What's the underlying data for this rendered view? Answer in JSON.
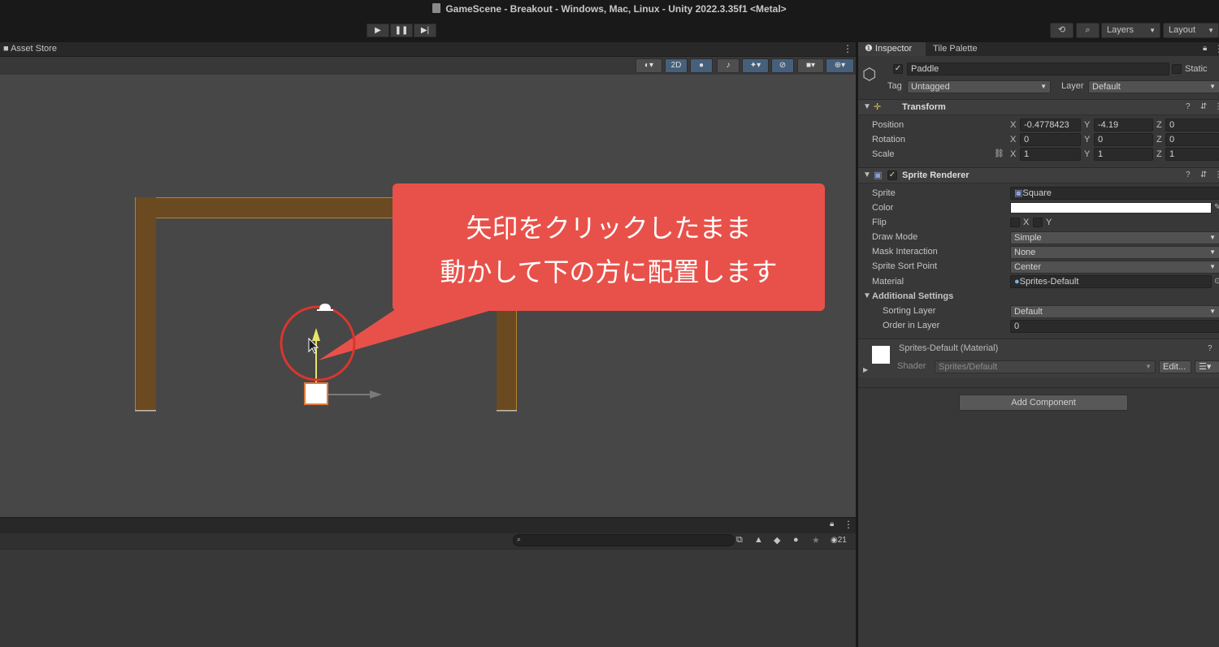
{
  "window": {
    "title": "GameScene - Breakout - Windows, Mac, Linux - Unity 2022.3.35f1 <Metal>"
  },
  "toolbar": {
    "play_icon": "play-icon",
    "pause_icon": "pause-icon",
    "step_icon": "step-icon",
    "layers_label": "Layers",
    "layout_label": "Layout"
  },
  "scene": {
    "tab_label": "Asset Store",
    "mode_2d_label": "2D",
    "callout_lines": [
      "矢印をクリックしたまま",
      "動かして下の方に配置します"
    ]
  },
  "console": {
    "count_label": "21"
  },
  "inspector": {
    "tabs": [
      "Inspector",
      "Tile Palette"
    ],
    "object": {
      "name": "Paddle",
      "static_label": "Static",
      "tag_label": "Tag",
      "tag_value": "Untagged",
      "layer_label": "Layer",
      "layer_value": "Default"
    },
    "transform": {
      "title": "Transform",
      "rows": [
        {
          "label": "Position",
          "x": "-0.4778423",
          "y": "-4.19",
          "z": "0"
        },
        {
          "label": "Rotation",
          "x": "0",
          "y": "0",
          "z": "0"
        },
        {
          "label": "Scale",
          "x": "1",
          "y": "1",
          "z": "1"
        }
      ],
      "axis_labels": [
        "X",
        "Y",
        "Z"
      ]
    },
    "sprite_renderer": {
      "title": "Sprite Renderer",
      "sprite_label": "Sprite",
      "sprite_value": "Square",
      "color_label": "Color",
      "color_value": "#ffffff",
      "flip_label": "Flip",
      "flip_x": "X",
      "flip_y": "Y",
      "draw_mode_label": "Draw Mode",
      "draw_mode_value": "Simple",
      "mask_label": "Mask Interaction",
      "mask_value": "None",
      "sort_point_label": "Sprite Sort Point",
      "sort_point_value": "Center",
      "material_label": "Material",
      "material_value": "Sprites-Default",
      "additional_label": "Additional Settings",
      "sorting_layer_label": "Sorting Layer",
      "sorting_layer_value": "Default",
      "order_label": "Order in Layer",
      "order_value": "0"
    },
    "material": {
      "title": "Sprites-Default (Material)",
      "shader_label": "Shader",
      "shader_value": "Sprites/Default",
      "edit_label": "Edit..."
    },
    "add_component_label": "Add Component"
  },
  "colors": {
    "accent": "#46607c",
    "callout": "#e8514a",
    "wall": "#6b4a22",
    "selection": "#e07a3a"
  }
}
